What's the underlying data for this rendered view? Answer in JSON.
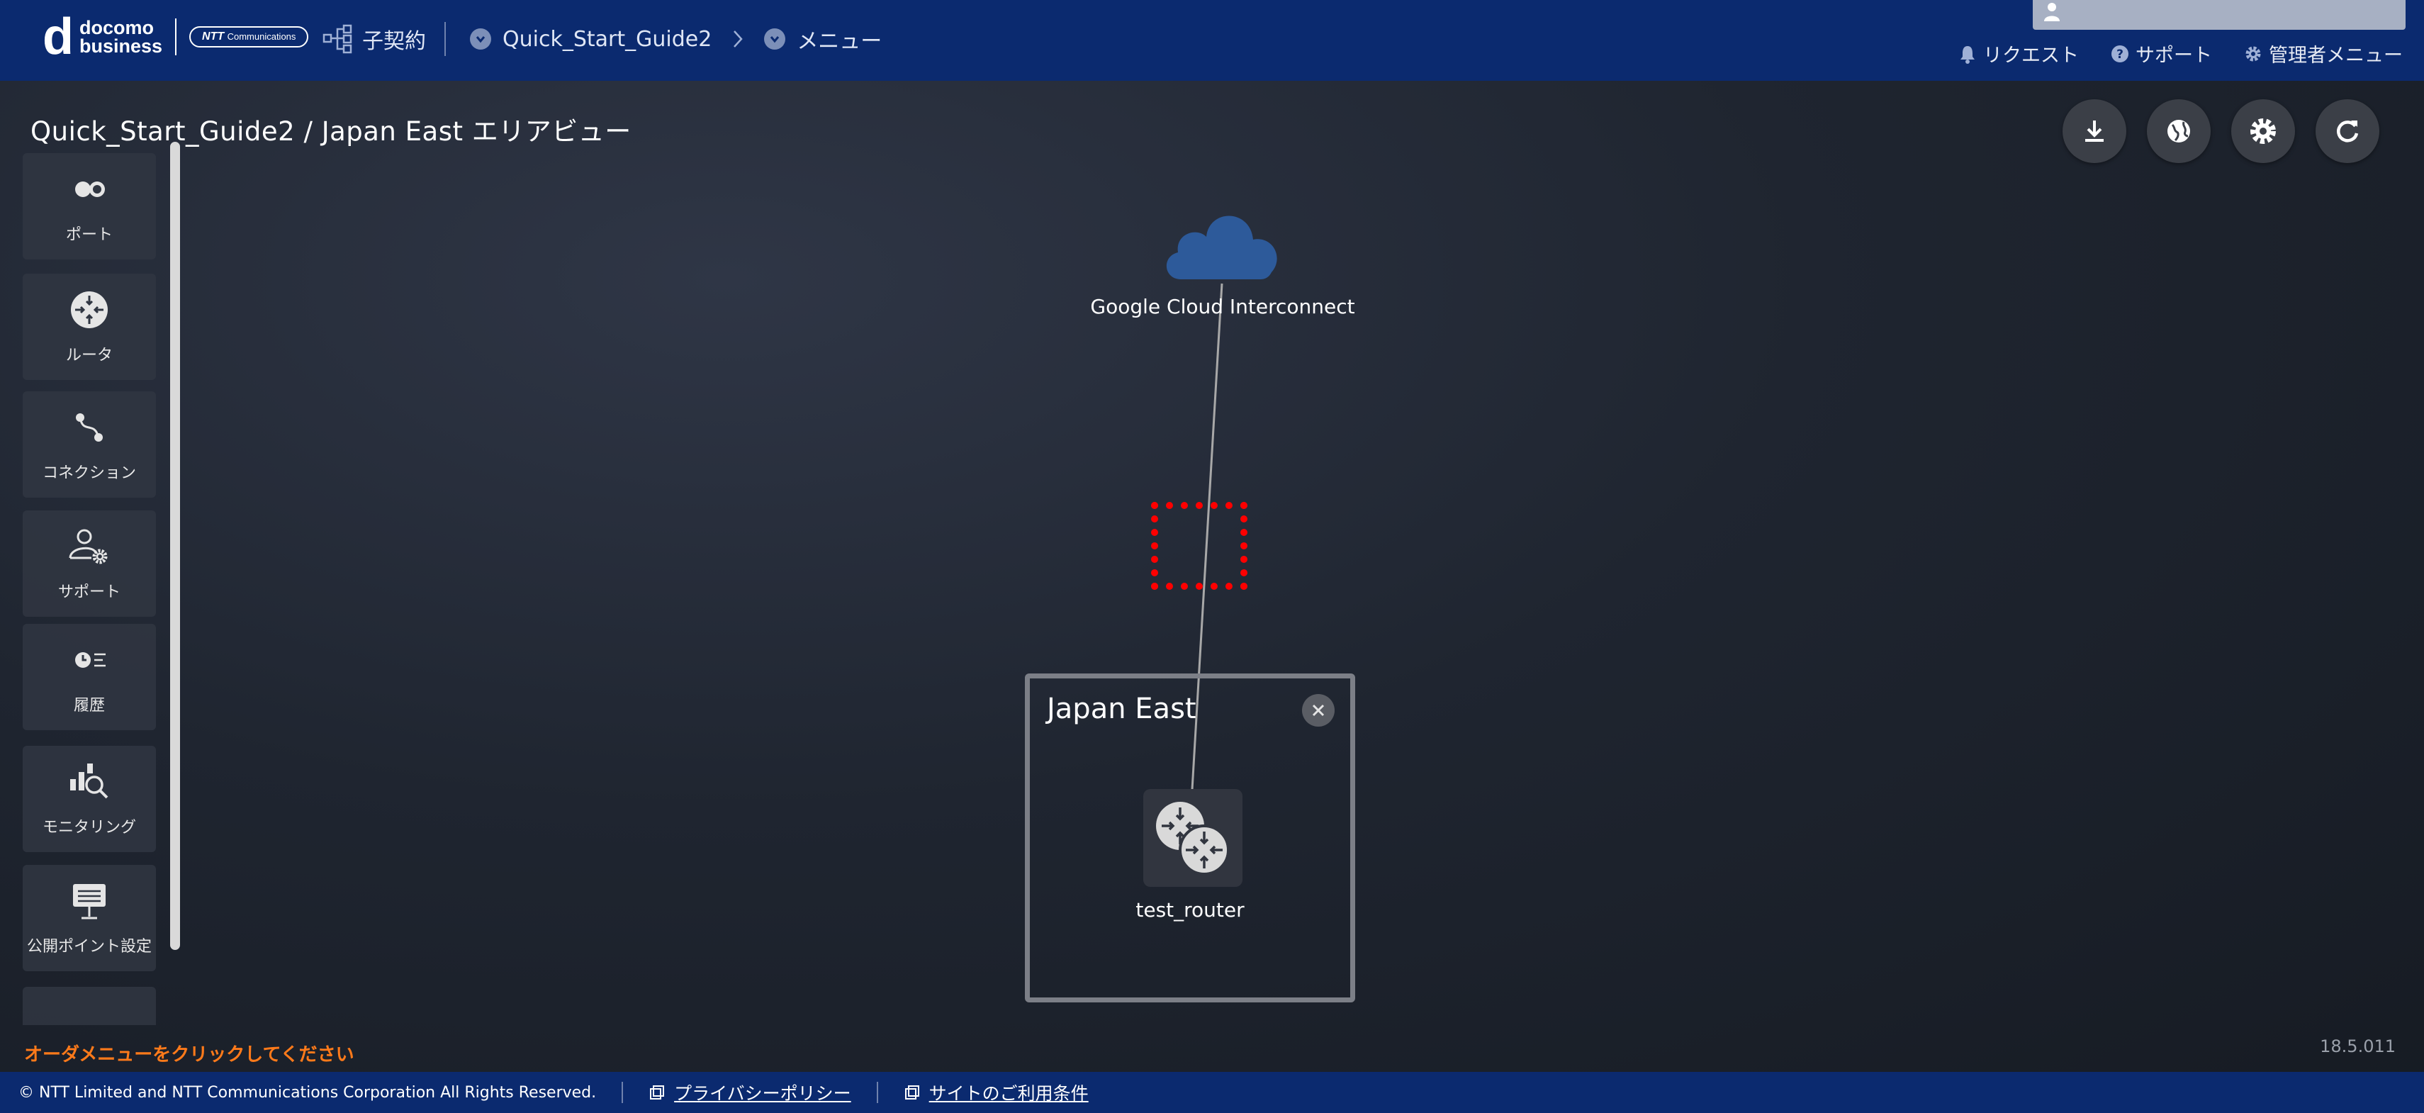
{
  "header": {
    "logo": {
      "mark": "d",
      "line1": "docomo",
      "line2": "business",
      "partner": "NTT",
      "partner_sub": "Communications"
    },
    "contract_label": "子契約",
    "breadcrumb": [
      {
        "label": "Quick_Start_Guide2"
      },
      {
        "label": "メニュー"
      }
    ],
    "right_links": {
      "request": "リクエスト",
      "support": "サポート",
      "admin_menu": "管理者メニュー"
    }
  },
  "page_title": "Quick_Start_Guide2 / Japan East エリアビュー",
  "sidebar": {
    "items": [
      {
        "label": "ポート",
        "icon": "port-icon"
      },
      {
        "label": "ルータ",
        "icon": "router-icon"
      },
      {
        "label": "コネクション",
        "icon": "connection-icon"
      },
      {
        "label": "サポート",
        "icon": "support-user-icon"
      },
      {
        "label": "履歴",
        "icon": "history-icon"
      },
      {
        "label": "モニタリング",
        "icon": "monitoring-icon"
      },
      {
        "label": "公開ポイント設定",
        "icon": "public-point-icon"
      }
    ]
  },
  "actions": [
    {
      "name": "download",
      "icon": "download-icon"
    },
    {
      "name": "globe",
      "icon": "globe-icon"
    },
    {
      "name": "settings",
      "icon": "gear-icon"
    },
    {
      "name": "refresh",
      "icon": "refresh-icon"
    }
  ],
  "canvas": {
    "cloud_label": "Google Cloud Interconnect",
    "area": {
      "title": "Japan East",
      "router_label": "test_router"
    }
  },
  "order_message": "オーダメニューをクリックしてください",
  "version": "18.5.011",
  "footer": {
    "copyright": "© NTT Limited and NTT Communications Corporation All Rights Reserved.",
    "privacy": "プライバシーポリシー",
    "terms": "サイトのご利用条件"
  },
  "colors": {
    "header_bg": "#0b2a6f",
    "accent_orange": "#ff7a1a",
    "highlight_red": "#ff0000",
    "cloud_blue": "#2d5a9a"
  }
}
